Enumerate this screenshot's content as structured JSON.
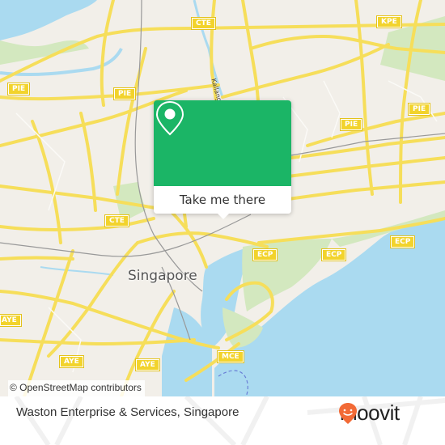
{
  "map": {
    "city_label": "Singapore",
    "street_label": "Kallang",
    "attribution": "© OpenStreetMap contributors",
    "colors": {
      "land": "#f2efe9",
      "water": "#aadaf0",
      "park": "#d3e8bf",
      "road": "#f6de5a",
      "road_outline": "#e8c94a",
      "rail": "#999999"
    },
    "shields": [
      {
        "label": "CTE"
      },
      {
        "label": "KPE"
      },
      {
        "label": "PIE"
      },
      {
        "label": "PIE"
      },
      {
        "label": "PIE"
      },
      {
        "label": "PIE"
      },
      {
        "label": "CTE"
      },
      {
        "label": "ECP"
      },
      {
        "label": "ECP"
      },
      {
        "label": "ECP"
      },
      {
        "label": "AYE"
      },
      {
        "label": "AYE"
      },
      {
        "label": "MCE"
      },
      {
        "label": "AYE"
      }
    ]
  },
  "popup": {
    "icon": "location-pin-icon",
    "button_label": "Take me there",
    "color": "#1bb566"
  },
  "footer": {
    "place_name": "Waston Enterprise & Services, Singapore",
    "brand": "moovit",
    "brand_color": "#f26a36"
  }
}
